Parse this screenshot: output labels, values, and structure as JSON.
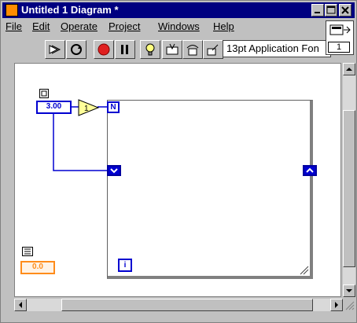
{
  "window": {
    "title": "Untitled 1 Diagram *",
    "controls": {
      "minimize": "minimize",
      "maximize": "maximize",
      "close": "close"
    }
  },
  "menu": {
    "items": [
      {
        "label": "File"
      },
      {
        "label": "Edit"
      },
      {
        "label": "Operate"
      },
      {
        "label": "Project"
      },
      {
        "label": "Windows"
      },
      {
        "label": "Help"
      }
    ]
  },
  "toolbar": {
    "font_selector": "13pt Application Fon",
    "buttons": [
      "run-arrow-icon",
      "run-continuous-icon",
      "abort-icon",
      "pause-icon",
      "highlight-execution-icon",
      "step-into-icon",
      "step-over-icon",
      "step-out-icon"
    ]
  },
  "context_help": {
    "value": "1"
  },
  "diagram": {
    "constant_count_value": "3.00",
    "subtract_node": "1",
    "loop_count": "N",
    "loop_iteration": "i",
    "orange_constant": "0.0"
  },
  "colors": {
    "title_bar": "#000080",
    "terminal_blue": "#0000d0",
    "wire_blue": "#0000d0",
    "orange": "#ff8c1a"
  }
}
